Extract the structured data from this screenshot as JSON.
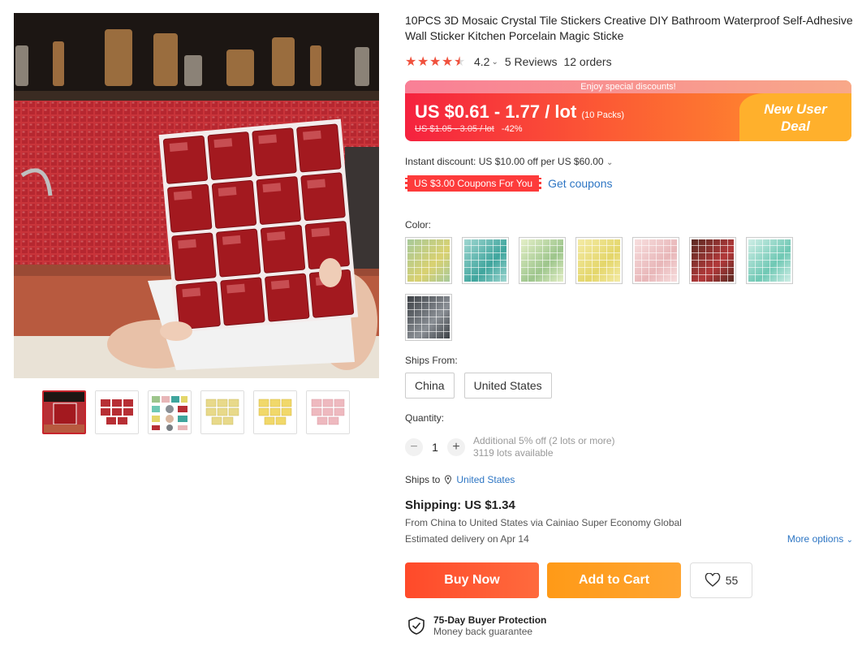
{
  "product": {
    "title": "10PCS 3D Mosaic Crystal Tile Stickers Creative DIY Bathroom Waterproof Self-Adhesive Wall Sticker Kitchen Porcelain Magic Sticke",
    "rating_value": "4.2",
    "rating_stars": 4.5,
    "reviews": "5 Reviews",
    "orders": "12 orders"
  },
  "price": {
    "banner": "Enjoy special discounts!",
    "current": "US $0.61 - 1.77 / lot",
    "packs": "(10 Packs)",
    "original": "US $1.05 - 3.05 / lot",
    "discount": "-42%",
    "new_user_line1": "New User",
    "new_user_line2": "Deal"
  },
  "promo": {
    "instant_discount": "Instant discount: US $10.00 off per US $60.00",
    "coupon_chip": "US $3.00 Coupons For You",
    "get_coupons": "Get coupons"
  },
  "color": {
    "label": "Color:",
    "swatches": [
      {
        "name": "yellow-green-mosaic",
        "c1": "#d9d170",
        "c2": "#a7c99a"
      },
      {
        "name": "teal-mosaic",
        "c1": "#3fa59d",
        "c2": "#9fd6d0"
      },
      {
        "name": "green-mosaic",
        "c1": "#9dc58c",
        "c2": "#e4efc7"
      },
      {
        "name": "yellow-mosaic",
        "c1": "#e4d66a",
        "c2": "#f4eba6"
      },
      {
        "name": "pink-mosaic",
        "c1": "#e8b6b8",
        "c2": "#f7dede"
      },
      {
        "name": "red-mosaic",
        "c1": "#b3393a",
        "c2": "#5a2a22"
      },
      {
        "name": "mint-mosaic",
        "c1": "#6fc8b4",
        "c2": "#cfeee6"
      },
      {
        "name": "grey-mosaic",
        "c1": "#8a8f95",
        "c2": "#3b3f44"
      }
    ]
  },
  "ships_from": {
    "label": "Ships From:",
    "options": [
      "China",
      "United States"
    ]
  },
  "quantity": {
    "label": "Quantity:",
    "value": "1",
    "note1": "Additional 5% off (2 lots or more)",
    "note2": "3119 lots available"
  },
  "shipping": {
    "ships_to_label": "Ships to",
    "ships_to_location": "United States",
    "title": "Shipping: US $1.34",
    "from_line": "From China to United States via Cainiao Super Economy Global",
    "estimated": "Estimated delivery on Apr 14",
    "more_options": "More options"
  },
  "actions": {
    "buy_now": "Buy Now",
    "add_to_cart": "Add to Cart",
    "wishlist_count": "55"
  },
  "protection": {
    "title": "75-Day Buyer Protection",
    "subtitle": "Money back guarantee"
  },
  "thumbnails": [
    {
      "name": "thumb-kitchen-red",
      "active": true
    },
    {
      "name": "thumb-red-tiles"
    },
    {
      "name": "thumb-multicolor-tiles"
    },
    {
      "name": "thumb-yellow-tiles-1"
    },
    {
      "name": "thumb-yellow-tiles-2"
    },
    {
      "name": "thumb-pink-tiles"
    }
  ],
  "colors": {
    "accent_red": "#f0513d",
    "link_blue": "#2e76c4",
    "buy_now": "#ff4a2a",
    "add_to_cart": "#ff9a17"
  }
}
